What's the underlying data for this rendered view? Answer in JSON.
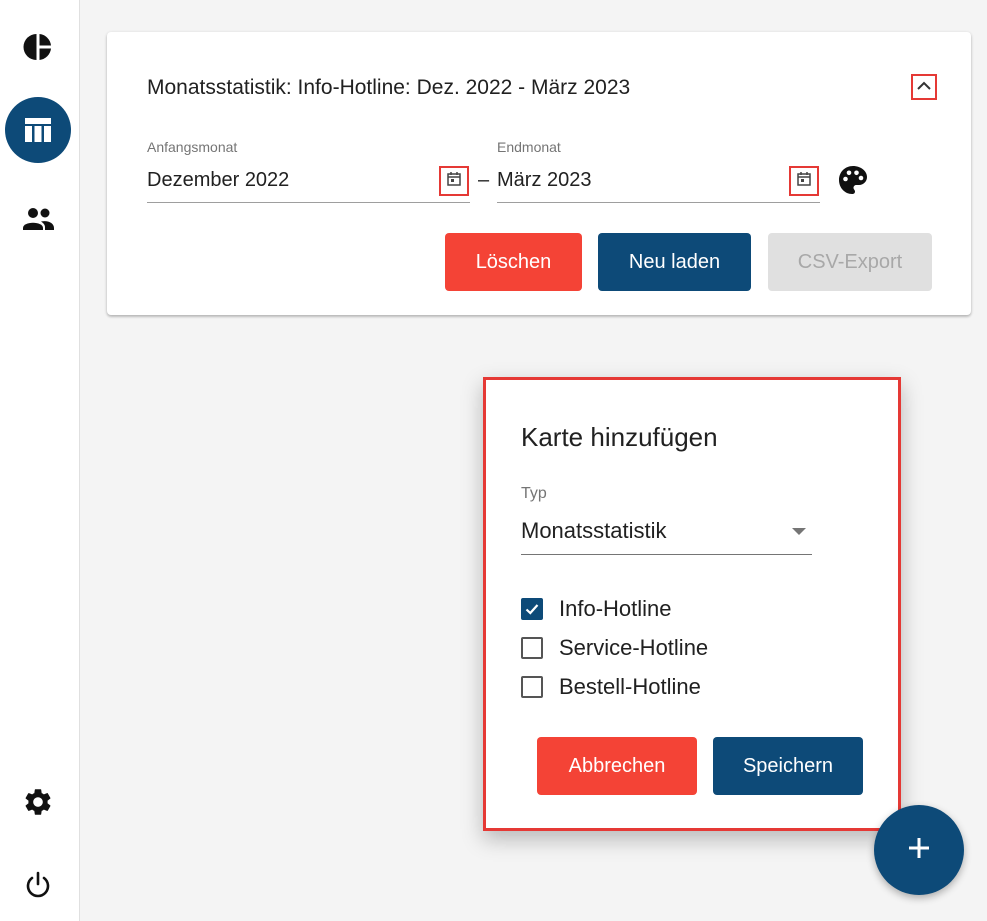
{
  "sidebar": {
    "items": [
      {
        "icon": "pie-chart-icon",
        "active": false
      },
      {
        "icon": "table-icon",
        "active": true
      },
      {
        "icon": "people-icon",
        "active": false
      }
    ],
    "bottom": [
      {
        "icon": "gear-icon"
      },
      {
        "icon": "power-icon"
      }
    ]
  },
  "card": {
    "title": "Monatsstatistik: Info-Hotline: Dez. 2022 - März 2023",
    "start": {
      "label": "Anfangsmonat",
      "value": "Dezember 2022"
    },
    "separator": "–",
    "end": {
      "label": "Endmonat",
      "value": "März 2023"
    },
    "buttons": {
      "delete": "Löschen",
      "reload": "Neu laden",
      "export": "CSV-Export"
    }
  },
  "dialog": {
    "title": "Karte hinzufügen",
    "type_label": "Typ",
    "type_value": "Monatsstatistik",
    "options": [
      {
        "label": "Info-Hotline",
        "checked": true
      },
      {
        "label": "Service-Hotline",
        "checked": false
      },
      {
        "label": "Bestell-Hotline",
        "checked": false
      }
    ],
    "cancel_label": "Abbrechen",
    "save_label": "Speichern"
  },
  "fab": {
    "label": "+"
  },
  "colors": {
    "primary": "#0d4a78",
    "danger": "#f44336",
    "highlight": "#e53935",
    "disabled": "#e0e0e0"
  }
}
